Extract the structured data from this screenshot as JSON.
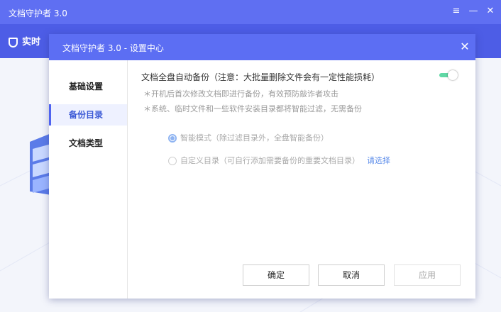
{
  "app": {
    "title": "文档守护者 3.0",
    "active_tab": "实时"
  },
  "window_controls": {
    "menu": "≡",
    "minimize": "—",
    "close": "✕"
  },
  "dialog": {
    "title": "文档守护者 3.0 - 设置中心",
    "close": "✕",
    "sidebar": {
      "items": [
        {
          "label": "基础设置",
          "active": false
        },
        {
          "label": "备份目录",
          "active": true
        },
        {
          "label": "文档类型",
          "active": false
        }
      ]
    },
    "main": {
      "setting_title": "文档全盘自动备份（注意：大批量删除文件会有一定性能损耗）",
      "toggle_on": true,
      "notes": [
        "＊开机后首次修改文档即进行备份，有效预防敲诈者攻击",
        "＊系统、临时文件和一些软件安装目录都将智能过滤，无需备份"
      ],
      "options": [
        {
          "label": "智能模式（除过滤目录外，全盘智能备份）",
          "selected": true
        },
        {
          "label": "自定义目录（可自行添加需要备份的重要文档目录）",
          "selected": false,
          "link": "请选择"
        }
      ]
    },
    "buttons": {
      "confirm": "确定",
      "cancel": "取消",
      "apply": "应用"
    }
  }
}
